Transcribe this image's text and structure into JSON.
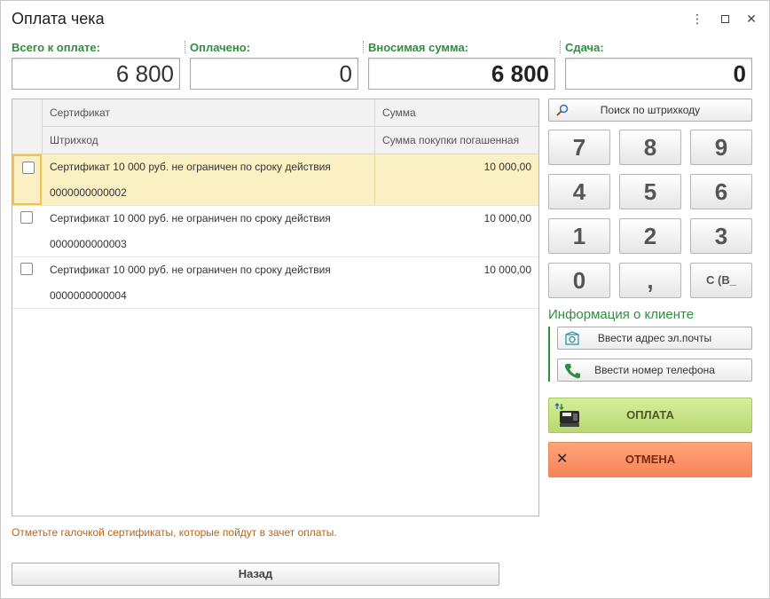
{
  "window": {
    "title": "Оплата чека"
  },
  "summary": {
    "total_label": "Всего к оплате:",
    "total_value": "6 800",
    "paid_label": "Оплачено:",
    "paid_value": "0",
    "deposit_label": "Вносимая сумма:",
    "deposit_value": "6 800",
    "change_label": "Сдача:",
    "change_value": "0"
  },
  "table": {
    "headers": {
      "certificate": "Сертификат",
      "amount": "Сумма",
      "barcode": "Штрихкод",
      "purchase_amount": "Сумма покупки погашенная"
    },
    "rows": [
      {
        "name": "Сертификат 10 000 руб. не ограничен по сроку действия",
        "code": "0000000000002",
        "amount": "10 000,00"
      },
      {
        "name": "Сертификат 10 000 руб. не ограничен по сроку действия",
        "code": "0000000000003",
        "amount": "10 000,00"
      },
      {
        "name": "Сертификат 10 000 руб. не ограничен по сроку действия",
        "code": "0000000000004",
        "amount": "10 000,00"
      }
    ]
  },
  "hint": "Отметьте галочкой сертификаты, которые пойдут в зачет оплаты.",
  "buttons": {
    "search_barcode": "Поиск по штрихкоду",
    "back": "Назад",
    "email": "Ввести адрес эл.почты",
    "phone": "Ввести номер телефона",
    "pay": "ОПЛАТА",
    "cancel": "ОТМЕНА"
  },
  "keypad": {
    "k7": "7",
    "k8": "8",
    "k9": "9",
    "k4": "4",
    "k5": "5",
    "k6": "6",
    "k1": "1",
    "k2": "2",
    "k3": "3",
    "k0": "0",
    "comma": ",",
    "clear": "C (B_"
  },
  "client_info": {
    "title": "Информация о клиенте"
  },
  "icons": {
    "search": "magnifier-icon",
    "email": "email-icon",
    "phone": "phone-icon",
    "pay": "cash-register-icon",
    "cancel": "cross-icon"
  },
  "colors": {
    "accent_green": "#2f8f3f",
    "selected_row": "#fbf0c4",
    "pay_button": "#c4e283",
    "cancel_button": "#f98f66",
    "hint_text": "#b5651d"
  }
}
